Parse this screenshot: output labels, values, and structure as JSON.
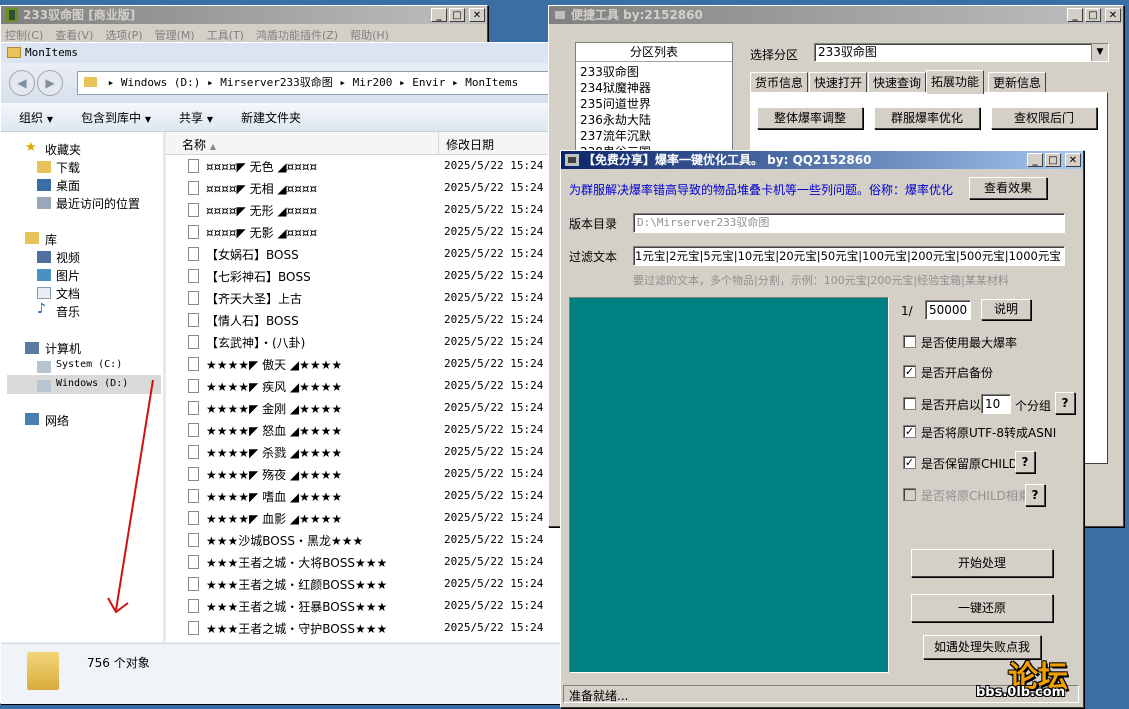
{
  "small_window": {
    "title": "233驭命图 [商业版]",
    "menu": [
      "控制(C)",
      "查看(V)",
      "选项(P)",
      "管理(M)",
      "工具(T)",
      "鸿盾功能插件(Z)",
      "帮助(H)"
    ]
  },
  "explorer": {
    "title": "MonItems",
    "breadcrumb": [
      "Windows (D:)",
      "Mirserver233驭命图",
      "Mir200",
      "Envir",
      "MonItems"
    ],
    "toolbar": [
      "组织",
      "包含到库中",
      "共享",
      "新建文件夹"
    ],
    "columns": {
      "name": "名称",
      "date": "修改日期"
    },
    "nav": {
      "favorites": "收藏夹",
      "downloads": "下载",
      "desktop": "桌面",
      "recent": "最近访问的位置",
      "library": "库",
      "videos": "视频",
      "pictures": "图片",
      "documents": "文档",
      "music": "音乐",
      "computer": "计算机",
      "system_drive": "System (C:)",
      "windows_drive": "Windows (D:)",
      "network": "网络"
    },
    "files": [
      {
        "name": "¤¤¤¤◤ 无色 ◢¤¤¤¤",
        "date": "2025/5/22 15:24"
      },
      {
        "name": "¤¤¤¤◤ 无相 ◢¤¤¤¤",
        "date": "2025/5/22 15:24"
      },
      {
        "name": "¤¤¤¤◤ 无形 ◢¤¤¤¤",
        "date": "2025/5/22 15:24"
      },
      {
        "name": "¤¤¤¤◤ 无影 ◢¤¤¤¤",
        "date": "2025/5/22 15:24"
      },
      {
        "name": "【女娲石】BOSS",
        "date": "2025/5/22 15:24"
      },
      {
        "name": "【七彩神石】BOSS",
        "date": "2025/5/22 15:24"
      },
      {
        "name": "【齐天大圣】上古",
        "date": "2025/5/22 15:24"
      },
      {
        "name": "【情人石】BOSS",
        "date": "2025/5/22 15:24"
      },
      {
        "name": "【玄武神】・(八卦)",
        "date": "2025/5/22 15:24"
      },
      {
        "name": "★★★★◤ 傲天 ◢★★★★",
        "date": "2025/5/22 15:24"
      },
      {
        "name": "★★★★◤ 疾风 ◢★★★★",
        "date": "2025/5/22 15:24"
      },
      {
        "name": "★★★★◤ 金刚 ◢★★★★",
        "date": "2025/5/22 15:24"
      },
      {
        "name": "★★★★◤ 怒血 ◢★★★★",
        "date": "2025/5/22 15:24"
      },
      {
        "name": "★★★★◤ 杀戮 ◢★★★★",
        "date": "2025/5/22 15:24"
      },
      {
        "name": "★★★★◤ 殇夜 ◢★★★★",
        "date": "2025/5/22 15:24"
      },
      {
        "name": "★★★★◤ 嗜血 ◢★★★★",
        "date": "2025/5/22 15:24"
      },
      {
        "name": "★★★★◤ 血影 ◢★★★★",
        "date": "2025/5/22 15:24"
      },
      {
        "name": "★★★沙城BOSS・黑龙★★★",
        "date": "2025/5/22 15:24"
      },
      {
        "name": "★★★王者之城・大将BOSS★★★",
        "date": "2025/5/22 15:24"
      },
      {
        "name": "★★★王者之城・红颜BOSS★★★",
        "date": "2025/5/22 15:24"
      },
      {
        "name": "★★★王者之城・狂暴BOSS★★★",
        "date": "2025/5/22 15:24"
      },
      {
        "name": "★★★王者之城・守护BOSS★★★",
        "date": "2025/5/22 15:24"
      }
    ],
    "status": "756 个对象"
  },
  "quick_tool": {
    "title": "便捷工具   by:2152860",
    "partition_header": "分区列表",
    "partitions": [
      "233驭命图",
      "234狱魔神器",
      "235问道世界",
      "236永劫大陆",
      "237流年沉默",
      "238鬼谷三国"
    ],
    "select_label": "选择分区",
    "select_value": "233驭命图",
    "tabs": [
      "货币信息",
      "快速打开",
      "快速查询",
      "拓展功能",
      "更新信息"
    ],
    "buttons": [
      "整体爆率调整",
      "群服爆率优化",
      "查权限后门"
    ]
  },
  "optimizer": {
    "title": "【免费分享】爆率一键优化工具。   by: QQ2152860",
    "description": "为群服解决爆率错高导致的物品堆叠卡机等一些列问题。俗称：爆率优化",
    "view_effect": "查看效果",
    "version_label": "版本目录",
    "version_value": "D:\\Mirserver233驭命图",
    "filter_label": "过滤文本",
    "filter_value": "1元宝|2元宝|5元宝|10元宝|20元宝|50元宝|100元宝|200元宝|500元宝|1000元宝",
    "filter_hint": "要过滤的文本，多个物品|分割，示例：100元宝|200元宝|经验宝箱|某某材料",
    "ratio_prefix": "1/",
    "ratio_value": "50000",
    "explain_button": "说明",
    "options": [
      {
        "label": "是否使用最大爆率",
        "checked": false,
        "enabled": true
      },
      {
        "label": "是否开启备份",
        "checked": true,
        "enabled": true
      },
      {
        "label": "是否开启以",
        "checked": false,
        "enabled": true
      },
      {
        "label": "是否将原UTF-8转成ASNI",
        "checked": true,
        "enabled": true
      },
      {
        "label": "是否保留原CHILD",
        "checked": true,
        "enabled": true
      },
      {
        "label": "是否将原CHILD相乘",
        "checked": false,
        "enabled": false
      }
    ],
    "group_value": "10",
    "group_suffix": "个分组",
    "help_mark": "?",
    "start_button": "开始处理",
    "restore_button": "一键还原",
    "fail_button": "如遇处理失败点我",
    "status": "准备就绪...",
    "panel_color": "#008080"
  },
  "watermark": {
    "brand": "论坛",
    "url": "bbs.0lb.com"
  }
}
